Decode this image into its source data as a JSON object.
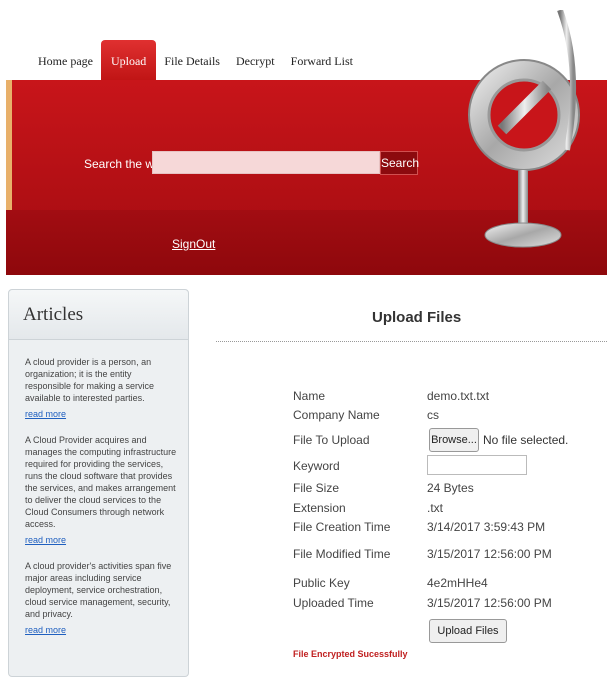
{
  "nav": {
    "items": [
      {
        "label": "Home page",
        "active": false
      },
      {
        "label": "Upload",
        "active": true
      },
      {
        "label": "File Details",
        "active": false
      },
      {
        "label": "Decrypt",
        "active": false
      },
      {
        "label": "Forward List",
        "active": false
      }
    ]
  },
  "banner": {
    "search_label": "Search the web:",
    "search_value": "",
    "search_button": "Search",
    "signout": "SignOut"
  },
  "sidebar": {
    "title": "Articles",
    "articles": [
      {
        "text": "A cloud provider is a person, an organization; it is the entity responsible for making a service available to interested parties.",
        "link": "read more"
      },
      {
        "text": "A Cloud Provider acquires and manages the computing infrastructure required for providing the services, runs the cloud software that provides the services, and makes arrangement to deliver the cloud services to the Cloud Consumers through network access.",
        "link": "read more"
      },
      {
        "text": "A cloud provider's activities span five major areas including service deployment, service orchestration, cloud service management, security, and privacy.",
        "link": "read more"
      }
    ]
  },
  "main": {
    "title": "Upload Files",
    "fields": {
      "name_label": "Name",
      "name_value": "demo.txt.txt",
      "company_label": "Company Name",
      "company_value": "cs",
      "file_label": "File To Upload",
      "browse_button": "Browse...",
      "no_file": "No file selected.",
      "keyword_label": "Keyword",
      "keyword_value": "",
      "size_label": "File Size",
      "size_value": "24 Bytes",
      "ext_label": "Extension",
      "ext_value": ".txt",
      "created_label": "File Creation Time",
      "created_value": "3/14/2017 3:59:43 PM",
      "modified_label": "File Modified Time",
      "modified_value": "3/15/2017 12:56:00 PM",
      "key_label": "Public Key",
      "key_value": "4e2mHHe4",
      "uploaded_label": "Uploaded Time",
      "uploaded_value": "3/15/2017 12:56:00 PM"
    },
    "upload_button": "Upload Files",
    "status": "File Encrypted Sucessfully"
  },
  "colors": {
    "banner_red": "#b10f14",
    "status_red": "#c02020",
    "link_blue": "#2060c0"
  }
}
